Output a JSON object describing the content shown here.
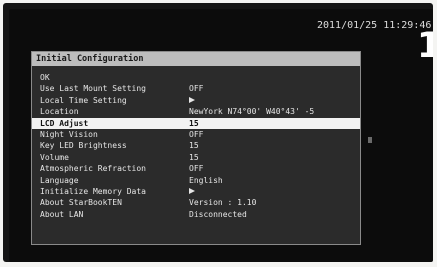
{
  "status": {
    "datetime": "2011/01/25 11:29:46",
    "page_number": "1"
  },
  "dialog": {
    "title": "Initial Configuration",
    "items": [
      {
        "label": "OK",
        "value": "",
        "icon": ""
      },
      {
        "label": "Use Last Mount Setting",
        "value": "OFF",
        "icon": ""
      },
      {
        "label": "Local Time Setting",
        "value": "",
        "icon": "right-arrow-icon"
      },
      {
        "label": "Location",
        "value": "NewYork N74°00' W40°43' -5",
        "icon": ""
      },
      {
        "label": "LCD Adjust",
        "value": "15",
        "icon": "",
        "selected": true
      },
      {
        "label": "Night Vision",
        "value": "OFF",
        "icon": ""
      },
      {
        "label": "Key LED Brightness",
        "value": "15",
        "icon": ""
      },
      {
        "label": "Volume",
        "value": "15",
        "icon": ""
      },
      {
        "label": "Atmospheric Refraction",
        "value": "OFF",
        "icon": ""
      },
      {
        "label": "Language",
        "value": "English",
        "icon": ""
      },
      {
        "label": "Initialize Memory Data",
        "value": "",
        "icon": "right-arrow-icon"
      },
      {
        "label": "About StarBookTEN",
        "value": "Version : 1.10",
        "icon": ""
      },
      {
        "label": "About LAN",
        "value": "Disconnected",
        "icon": ""
      }
    ]
  }
}
